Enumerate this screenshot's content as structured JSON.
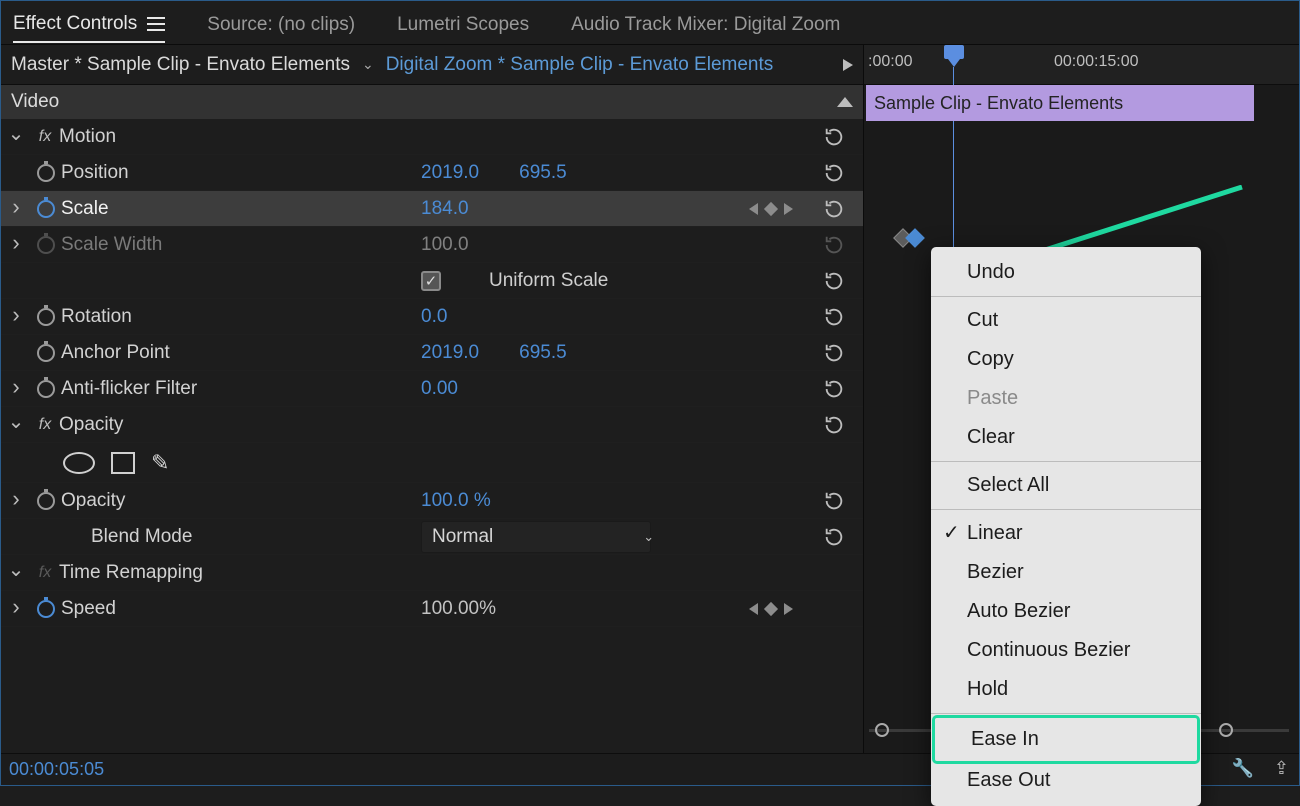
{
  "tabs": {
    "effect_controls": "Effect Controls",
    "source": "Source: (no clips)",
    "lumetri": "Lumetri Scopes",
    "mixer": "Audio Track Mixer: Digital Zoom"
  },
  "breadcrumb": {
    "master": "Master * Sample Clip - Envato Elements",
    "clip": "Digital Zoom * Sample Clip - Envato Elements"
  },
  "sections": {
    "video": "Video"
  },
  "effects": {
    "motion": {
      "label": "Motion",
      "position": {
        "label": "Position",
        "x": "2019.0",
        "y": "695.5"
      },
      "scale": {
        "label": "Scale",
        "value": "184.0"
      },
      "scale_width": {
        "label": "Scale Width",
        "value": "100.0"
      },
      "uniform": {
        "label": "Uniform Scale"
      },
      "rotation": {
        "label": "Rotation",
        "value": "0.0"
      },
      "anchor": {
        "label": "Anchor Point",
        "x": "2019.0",
        "y": "695.5"
      },
      "antiflicker": {
        "label": "Anti-flicker Filter",
        "value": "0.00"
      }
    },
    "opacity": {
      "label": "Opacity",
      "opacity": {
        "label": "Opacity",
        "value": "100.0 %"
      },
      "blend": {
        "label": "Blend Mode",
        "value": "Normal"
      }
    },
    "time": {
      "label": "Time Remapping",
      "speed": {
        "label": "Speed",
        "value": "100.00%"
      }
    }
  },
  "timeline": {
    "t0": ":00:00",
    "t15": "00:00:15:00",
    "clip": "Sample Clip - Envato Elements"
  },
  "context_menu": {
    "undo": "Undo",
    "cut": "Cut",
    "copy": "Copy",
    "paste": "Paste",
    "clear": "Clear",
    "select_all": "Select All",
    "linear": "Linear",
    "bezier": "Bezier",
    "auto_bezier": "Auto Bezier",
    "continuous_bezier": "Continuous Bezier",
    "hold": "Hold",
    "ease_in": "Ease In",
    "ease_out": "Ease Out"
  },
  "footer": {
    "timecode": "00:00:05:05"
  }
}
